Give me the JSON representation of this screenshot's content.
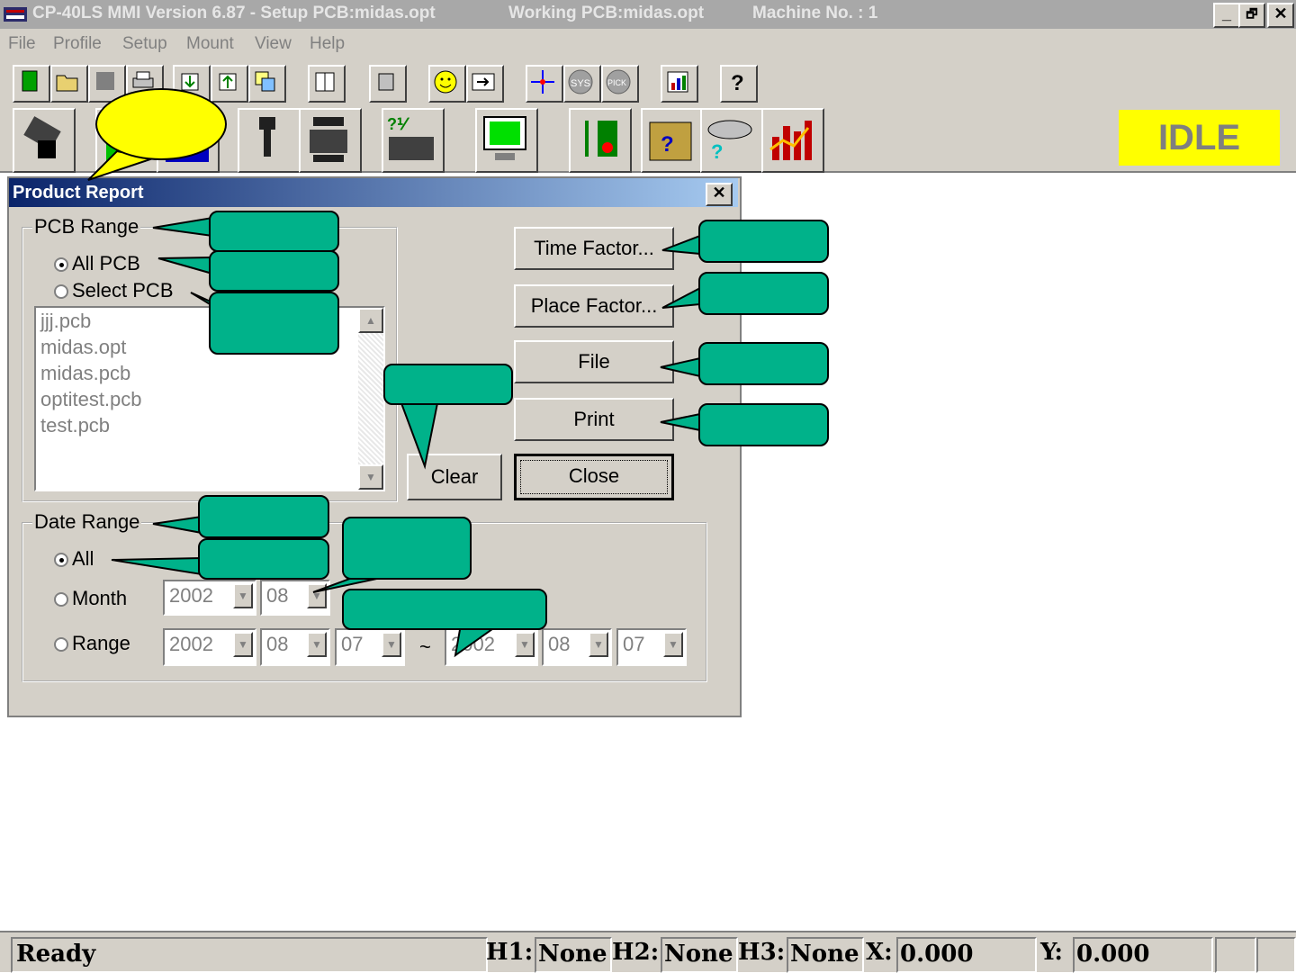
{
  "titlebar": {
    "app_title": "CP-40LS MMI Version 6.87 - Setup PCB:midas.opt",
    "working": "Working PCB:midas.opt",
    "machine": "Machine No. : 1",
    "min": "_",
    "max": "🗗",
    "close": "✕"
  },
  "menu": [
    "File",
    "Profile",
    "Setup",
    "Mount",
    "View",
    "Help"
  ],
  "status_indicator": "IDLE",
  "dialog": {
    "title": "Product Report",
    "close": "✕",
    "pcb_range": {
      "label": "PCB Range",
      "all_label": "All PCB",
      "select_label": "Select PCB",
      "items": [
        "jjj.pcb",
        "midas.opt",
        "midas.pcb",
        "optitest.pcb",
        "test.pcb"
      ]
    },
    "buttons": {
      "time_factor": "Time Factor...",
      "place_factor": "Place Factor...",
      "file": "File",
      "print": "Print",
      "clear": "Clear",
      "close": "Close"
    },
    "date_range": {
      "label": "Date Range",
      "all_label": "All",
      "month_label": "Month",
      "range_label": "Range",
      "month_year": "2002",
      "month_month": "08",
      "range_from_year": "2002",
      "range_from_month": "08",
      "range_from_day": "07",
      "tilde": "~",
      "range_to_year": "2002",
      "range_to_month": "08",
      "range_to_day": "07"
    }
  },
  "statusbar": {
    "text": "Ready",
    "h1_label": "H1:",
    "h1_value": "None",
    "h2_label": "H2:",
    "h2_value": "None",
    "h3_label": "H3:",
    "h3_value": "None",
    "x_label": "X:",
    "x_value": "0.000",
    "y_label": "Y:",
    "y_value": "0.000"
  }
}
